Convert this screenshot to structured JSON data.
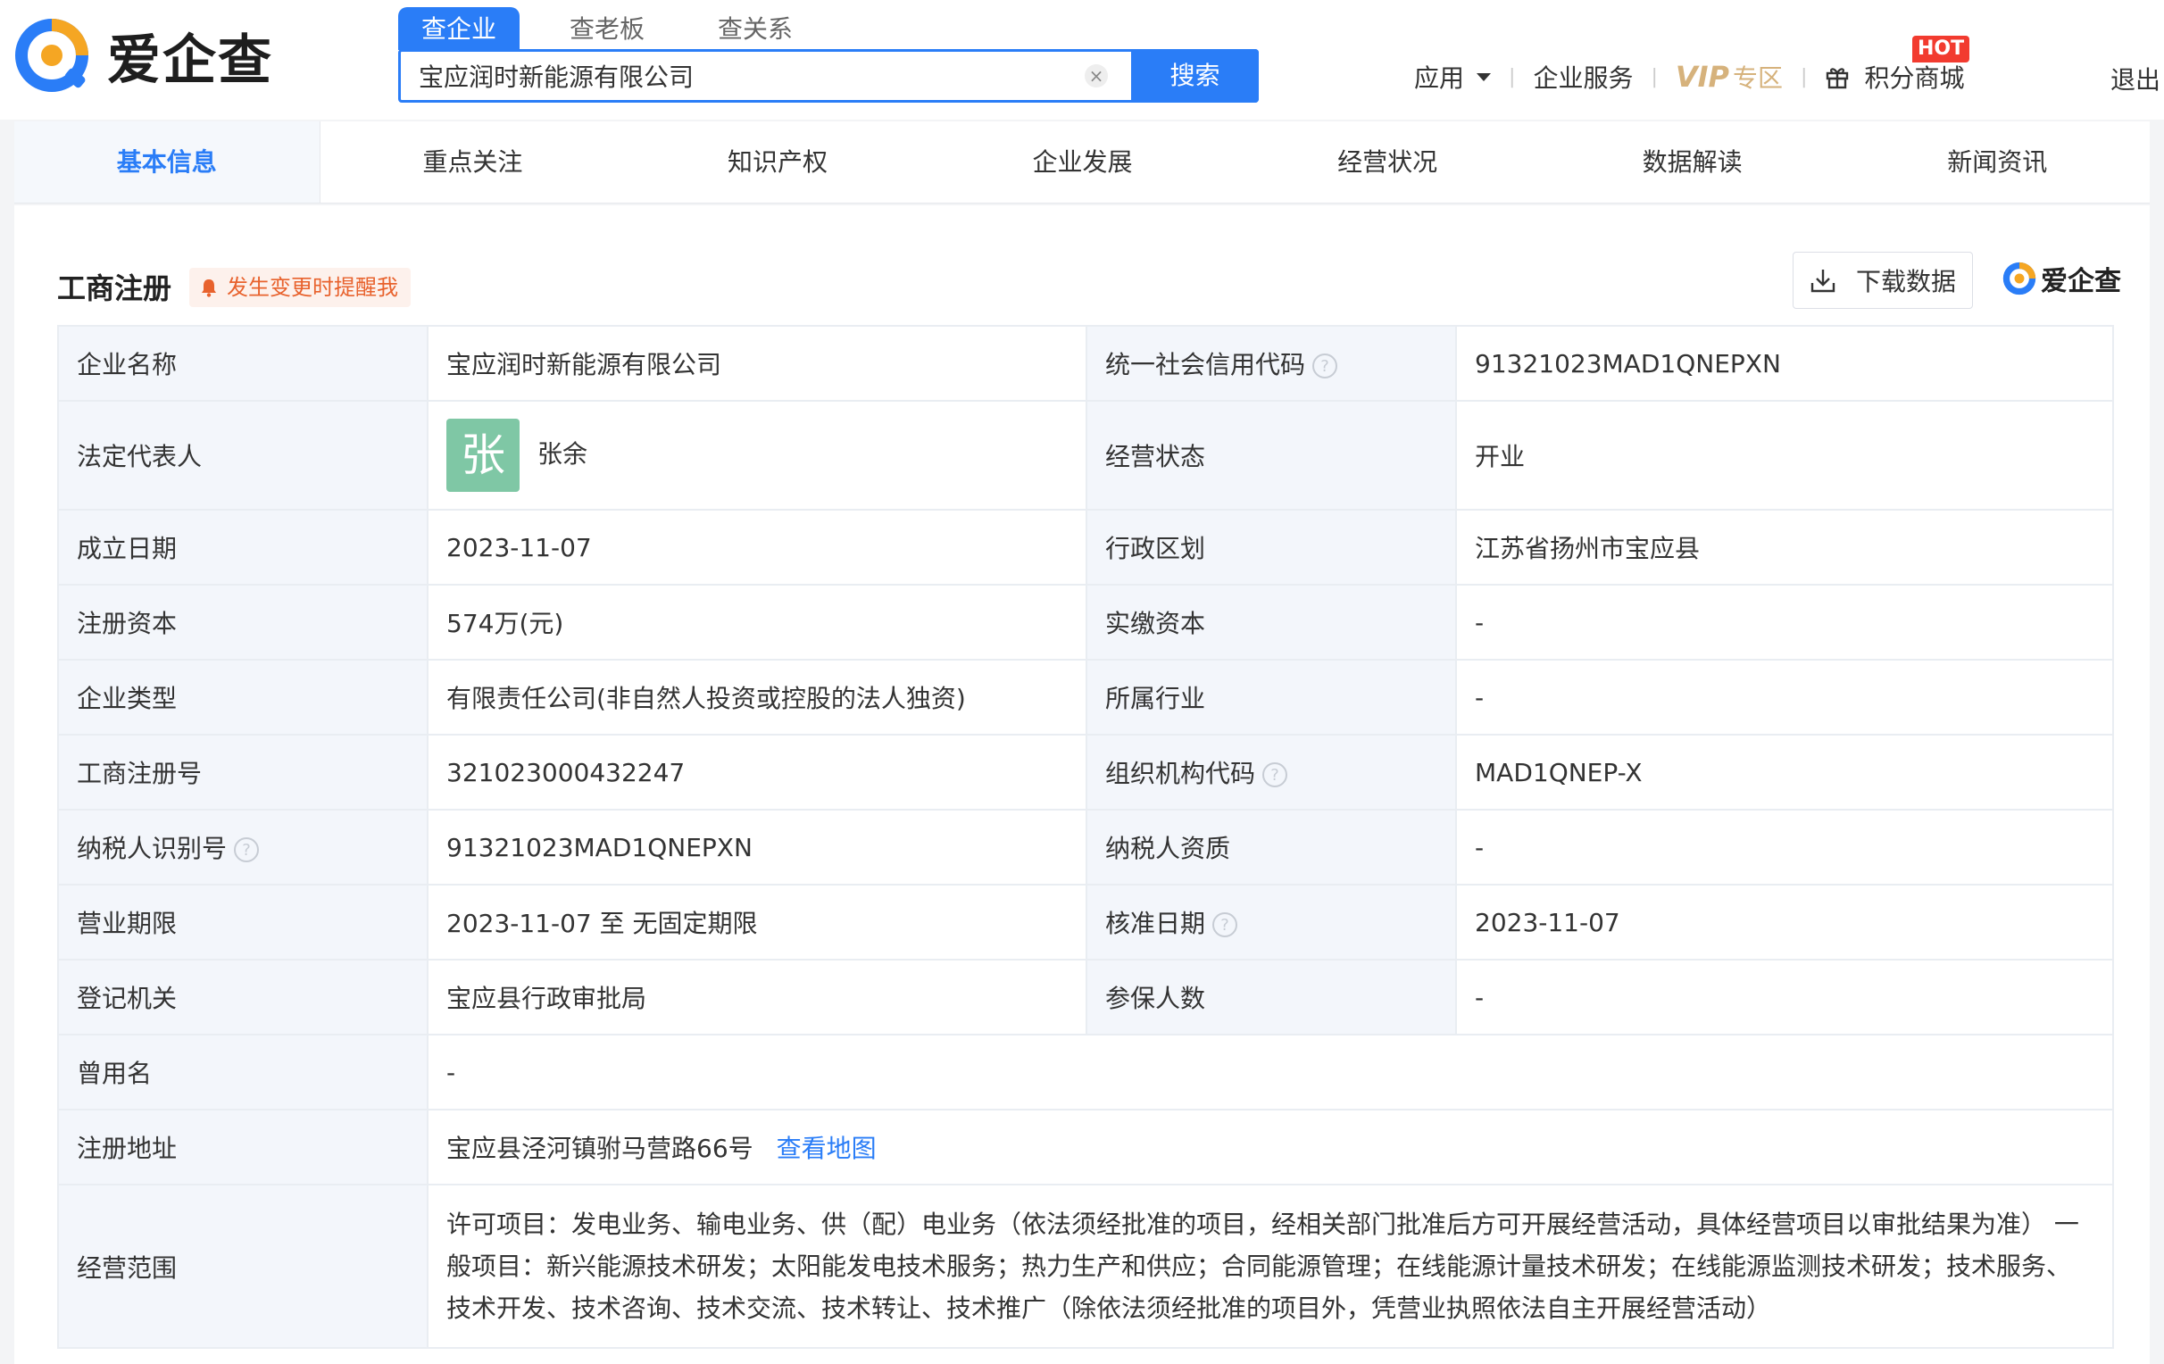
{
  "header": {
    "logo_text": "爱企查",
    "search_tabs": [
      "查企业",
      "查老板",
      "查关系"
    ],
    "search_value": "宝应润时新能源有限公司",
    "search_button": "搜索",
    "nav": {
      "apps": "应用",
      "enterprise_service": "企业服务",
      "vip": "VIP",
      "vip_sub": "专区",
      "points_mall": "积分商城",
      "hot_badge": "HOT",
      "logout": "退出"
    }
  },
  "tabs": [
    "基本信息",
    "重点关注",
    "知识产权",
    "企业发展",
    "经营状况",
    "数据解读",
    "新闻资讯"
  ],
  "section": {
    "title": "工商注册",
    "remind": "发生变更时提醒我",
    "download": "下载数据",
    "watermark_logo": "爱企查"
  },
  "info": {
    "name_label": "企业名称",
    "name": "宝应润时新能源有限公司",
    "credit_code_label": "统一社会信用代码",
    "credit_code": "91321023MAD1QNEPXN",
    "legal_rep_label": "法定代表人",
    "legal_rep_avatar": "张",
    "legal_rep": "张余",
    "status_label": "经营状态",
    "status": "开业",
    "found_date_label": "成立日期",
    "found_date": "2023-11-07",
    "region_label": "行政区划",
    "region": "江苏省扬州市宝应县",
    "reg_capital_label": "注册资本",
    "reg_capital": "574万(元)",
    "paid_capital_label": "实缴资本",
    "paid_capital": "-",
    "type_label": "企业类型",
    "type": "有限责任公司(非自然人投资或控股的法人独资)",
    "industry_label": "所属行业",
    "industry": "-",
    "reg_no_label": "工商注册号",
    "reg_no": "321023000432247",
    "org_code_label": "组织机构代码",
    "org_code": "MAD1QNEP-X",
    "tax_id_label": "纳税人识别号",
    "tax_id": "91321023MAD1QNEPXN",
    "tax_qual_label": "纳税人资质",
    "tax_qual": "-",
    "term_label": "营业期限",
    "term": "2023-11-07 至 无固定期限",
    "approval_date_label": "核准日期",
    "approval_date": "2023-11-07",
    "authority_label": "登记机关",
    "authority": "宝应县行政审批局",
    "insured_label": "参保人数",
    "insured": "-",
    "former_name_label": "曾用名",
    "former_name": "-",
    "address_label": "注册地址",
    "address": "宝应县泾河镇驸马营路66号",
    "map_link": "查看地图",
    "scope_label": "经营范围",
    "scope": "许可项目：发电业务、输电业务、供（配）电业务（依法须经批准的项目，经相关部门批准后方可开展经营活动，具体经营项目以审批结果为准） 一般项目：新兴能源技术研发；太阳能发电技术服务；热力生产和供应；合同能源管理；在线能源计量技术研发；在线能源监测技术研发；技术服务、技术开发、技术咨询、技术交流、技术转让、技术推广（除依法须经批准的项目外，凭营业执照依法自主开展经营活动）"
  }
}
